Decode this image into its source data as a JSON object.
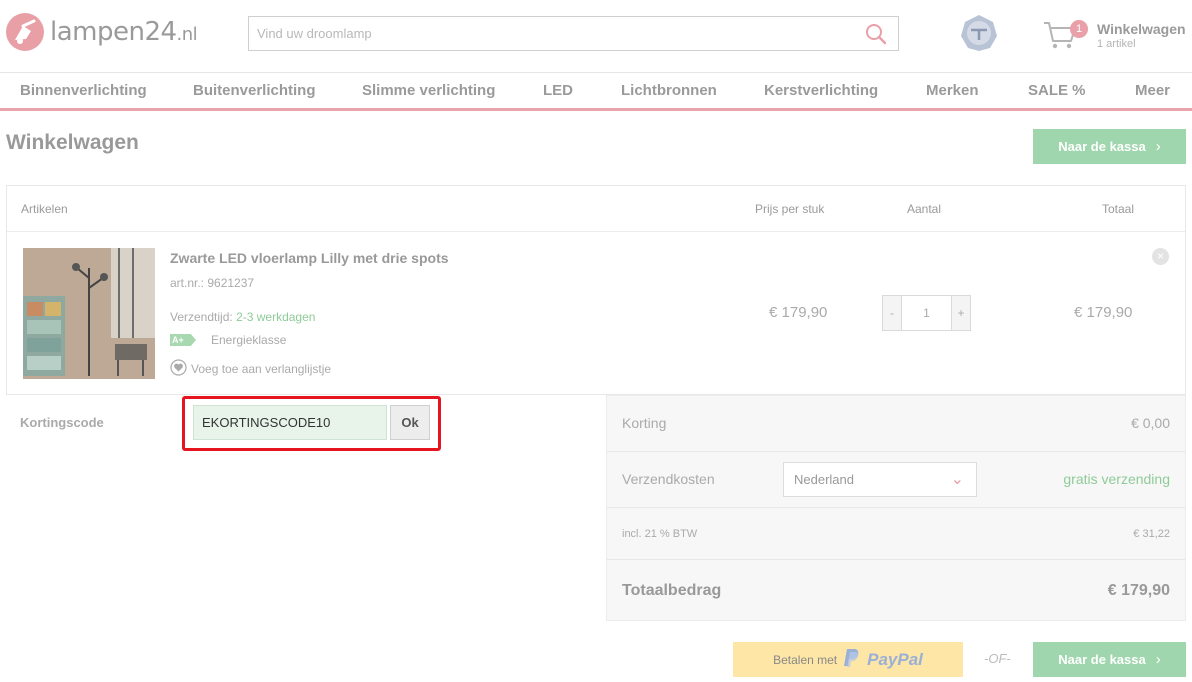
{
  "header": {
    "logo_text": "lampen24",
    "logo_tld": ".nl",
    "search_placeholder": "Vind uw droomlamp",
    "cart_title": "Winkelwagen",
    "cart_sub": "1 artikel",
    "cart_count": "1"
  },
  "nav": [
    "Binnenverlichting",
    "Buitenverlichting",
    "Slimme verlichting",
    "LED",
    "Lichtbronnen",
    "Kerstverlichting",
    "Merken",
    "SALE %",
    "Meer"
  ],
  "page": {
    "title": "Winkelwagen",
    "checkout_label": "Naar de kassa"
  },
  "table": {
    "headers": {
      "items": "Artikelen",
      "price": "Prijs per stuk",
      "qty": "Aantal",
      "total": "Totaal"
    }
  },
  "product": {
    "name": "Zwarte LED vloerlamp Lilly met drie spots",
    "art_no": "art.nr.: 9621237",
    "shipping_label": "Verzendtijd:",
    "shipping_value": "2-3 werkdagen",
    "energy_badge": "A+",
    "energy_label": "Energieklasse",
    "wishlist": "Voeg toe aan verlanglijstje",
    "price": "€ 179,90",
    "qty": "1",
    "total": "€ 179,90",
    "minus": "-",
    "plus": "+"
  },
  "coupon": {
    "label": "Kortingscode",
    "value": "EKORTINGSCODE10",
    "ok_label": "Ok"
  },
  "summary": {
    "discount_label": "Korting",
    "discount_value": "€ 0,00",
    "shipping_label": "Verzendkosten",
    "country": "Nederland",
    "shipping_value": "gratis verzending",
    "vat_label": "incl. 21 % BTW",
    "vat_value": "€ 31,22",
    "total_label": "Totaalbedrag",
    "total_value": "€ 179,90"
  },
  "bottom": {
    "paypal_prefix": "Betalen met",
    "paypal_word": "PayPal",
    "or_text": "-OF-"
  },
  "colors": {
    "brand_pink": "#e8a0a6",
    "checkout_green": "#9fd6ad",
    "highlight_red": "#e4151f",
    "paypal_yellow": "#fde6a6"
  }
}
